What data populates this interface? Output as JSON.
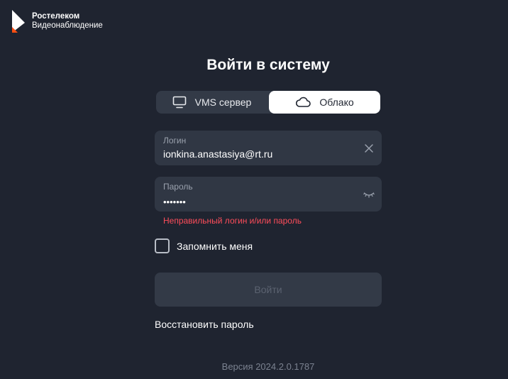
{
  "brand": {
    "name": "Ростелеком",
    "subtitle": "Видеонаблюдение",
    "logo_icon": "rostelecom-logo",
    "accent_color": "#ff4f12"
  },
  "title": "Войти в систему",
  "mode_tabs": [
    {
      "label": "VMS сервер",
      "icon": "monitor-icon",
      "selected": false
    },
    {
      "label": "Облако",
      "icon": "cloud-icon",
      "selected": true
    }
  ],
  "login_field": {
    "label": "Логин",
    "value": "ionkina.anastasiya@rt.ru",
    "icon": "clear-icon"
  },
  "password_field": {
    "label": "Пароль",
    "value": "•••••••",
    "icon": "eye-closed-icon"
  },
  "error_text": "Неправильный логин и/или пароль",
  "error_color": "#ff4d5a",
  "remember": {
    "label": "Запомнить меня",
    "checked": false
  },
  "login_button_label": "Войти",
  "restore_link": "Восстановить пароль",
  "version": "Версия 2024.2.0.1787"
}
